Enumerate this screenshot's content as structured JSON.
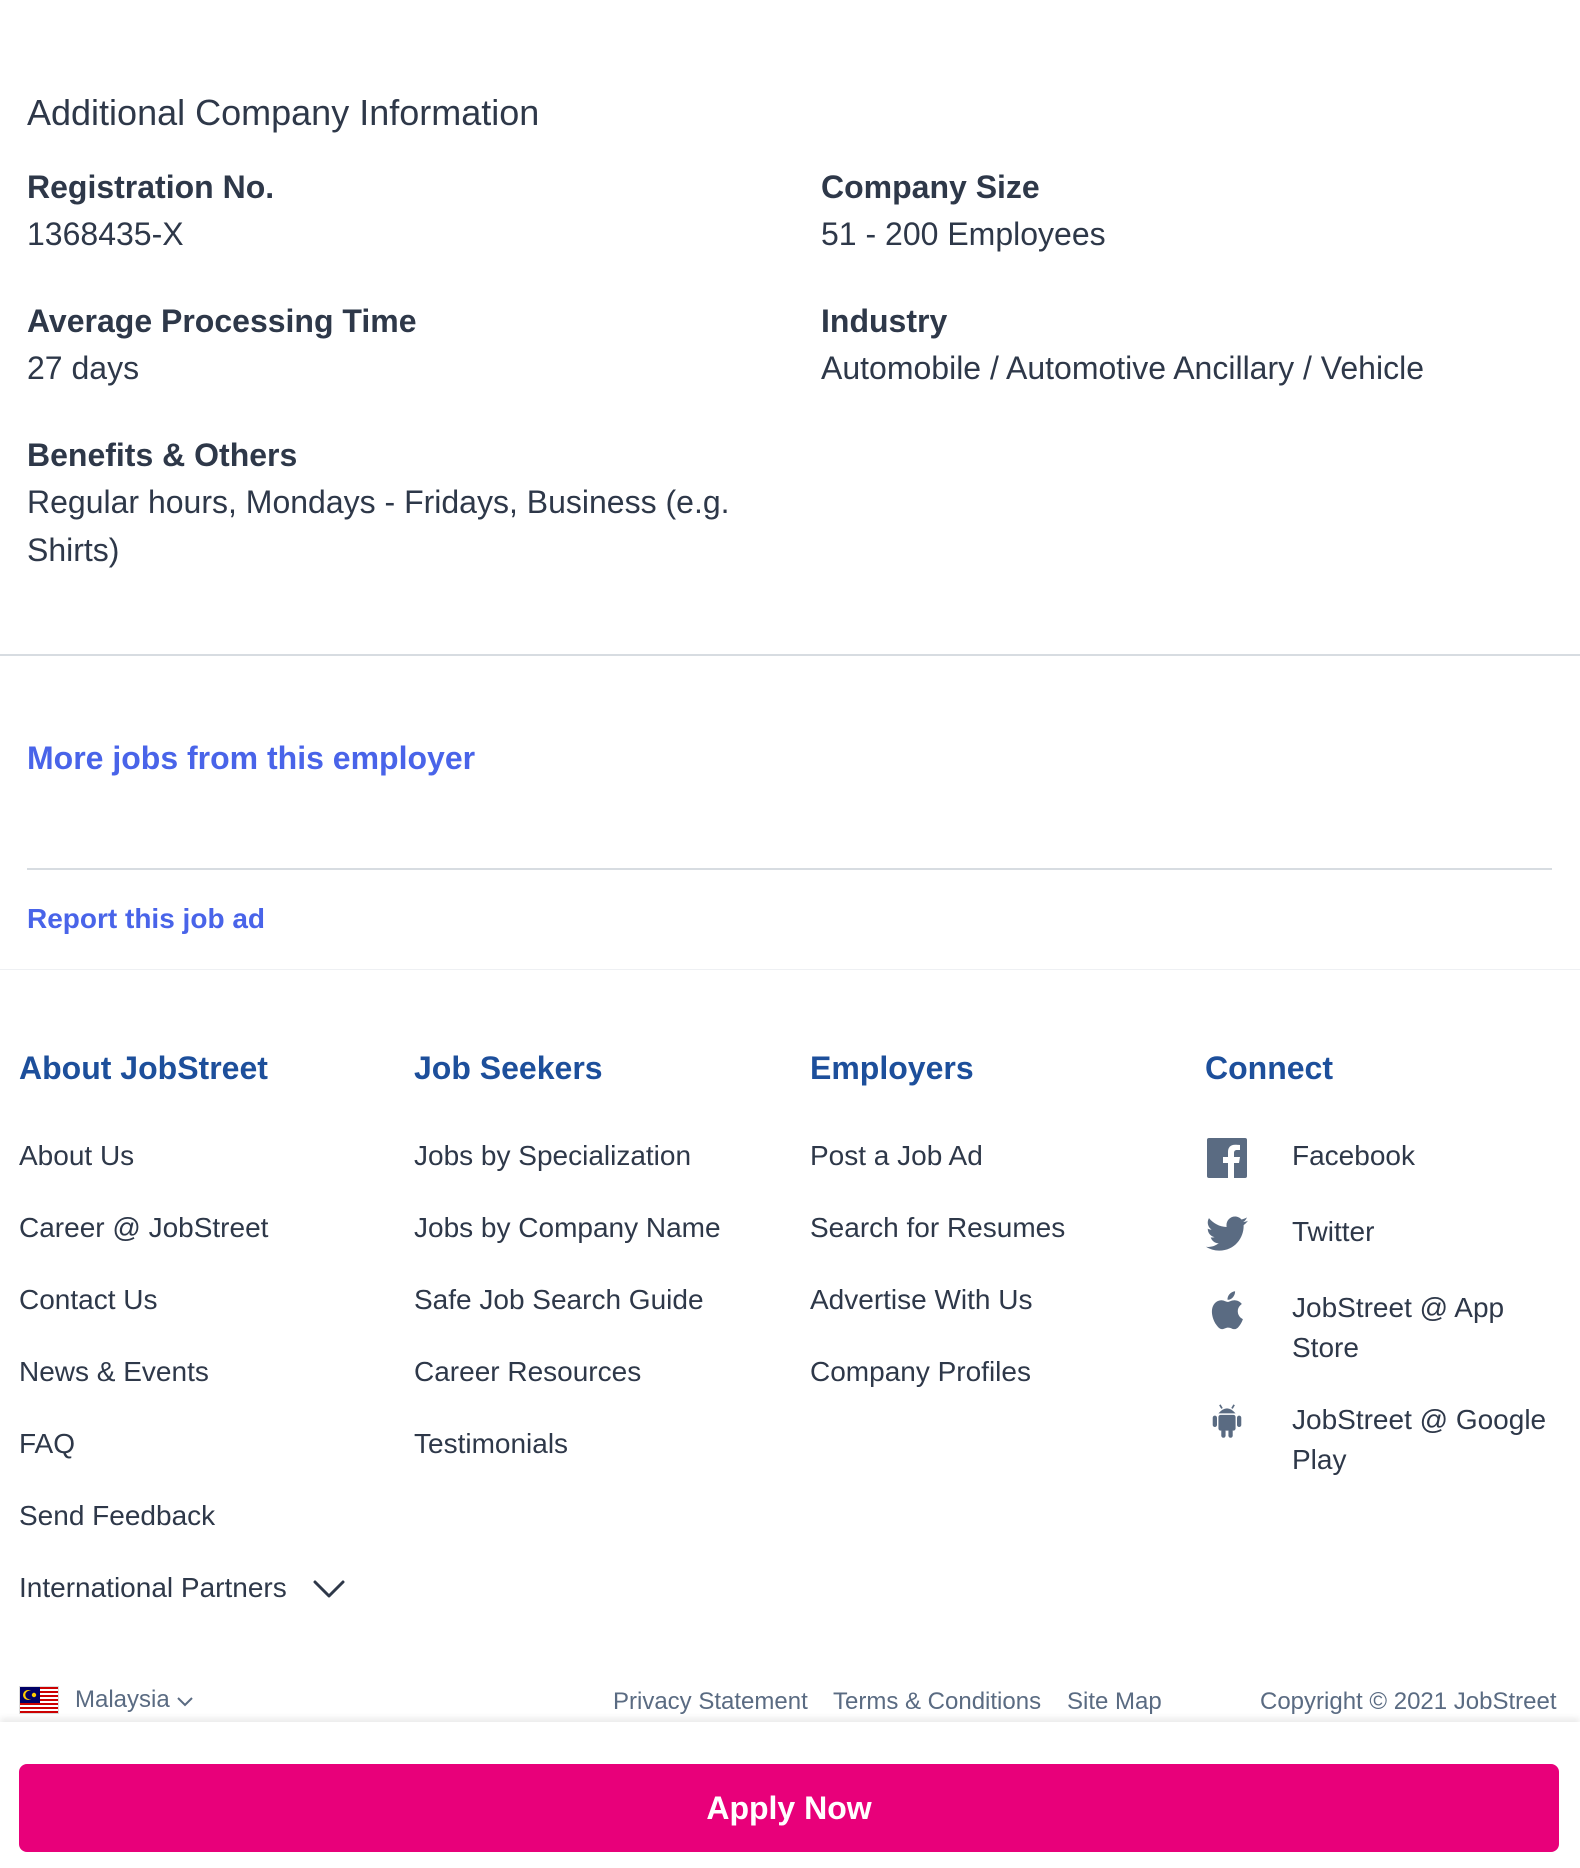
{
  "company": {
    "title": "Additional Company Information",
    "registration": {
      "label": "Registration No.",
      "value": "1368435-X"
    },
    "size": {
      "label": "Company Size",
      "value": "51 - 200 Employees"
    },
    "processing": {
      "label": "Average Processing Time",
      "value": "27 days"
    },
    "industry": {
      "label": "Industry",
      "value": "Automobile / Automotive Ancillary / Vehicle"
    },
    "benefits": {
      "label": "Benefits & Others",
      "value_line1": "Regular hours, Mondays - Fridays, Business (e.g.",
      "value_line2": "Shirts)"
    }
  },
  "links": {
    "more_jobs": "More jobs from this employer",
    "report": "Report this job ad"
  },
  "footer": {
    "about": {
      "heading": "About JobStreet",
      "items": [
        "About Us",
        "Career @ JobStreet",
        "Contact Us",
        "News & Events",
        "FAQ",
        "Send Feedback",
        "International Partners"
      ]
    },
    "seekers": {
      "heading": "Job Seekers",
      "items": [
        "Jobs by Specialization",
        "Jobs by Company Name",
        "Safe Job Search Guide",
        "Career Resources",
        "Testimonials"
      ]
    },
    "employers": {
      "heading": "Employers",
      "items": [
        "Post a Job Ad",
        "Search for Resumes",
        "Advertise With Us",
        "Company Profiles"
      ]
    },
    "connect": {
      "heading": "Connect",
      "items": [
        {
          "label": "Facebook",
          "icon": "facebook-icon"
        },
        {
          "label": "Twitter",
          "icon": "twitter-icon"
        },
        {
          "label": "JobStreet @ App Store",
          "icon": "apple-icon"
        },
        {
          "label": "JobStreet @ Google Play",
          "icon": "android-icon"
        }
      ]
    }
  },
  "bottom": {
    "country": "Malaysia",
    "privacy": "Privacy Statement",
    "terms": "Terms & Conditions",
    "sitemap": "Site Map",
    "copyright": "Copyright © 2021 JobStreet"
  },
  "apply": {
    "label": "Apply Now"
  },
  "colors": {
    "link": "#4964e9",
    "footer_heading": "#1d4f9b",
    "apply": "#e8007a",
    "text": "#2e3849"
  }
}
